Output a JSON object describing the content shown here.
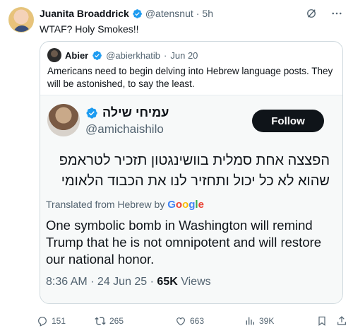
{
  "post": {
    "author_name": "Juanita Broaddrick",
    "author_handle": "@atensnut",
    "separator": "·",
    "time": "5h",
    "text": "WTAF?  Holy Smokes!!",
    "icons": {
      "grok": "grok-icon",
      "more": "more-icon",
      "verified": "verified-badge-icon"
    }
  },
  "quote": {
    "author_name": "Abier",
    "author_handle": "@abierkhatib",
    "separator": "·",
    "time": "Jun 20",
    "text": "Americans need to begin delving into Hebrew language posts. They will be astonished, to say the least."
  },
  "embedded": {
    "author_name": "עמיחי שילה",
    "author_handle": "@amichaishilo",
    "follow_label": "Follow",
    "hebrew_text": "הפצצה אחת סמלית בוושינגטון תזכיר לטראמפ שהוא לא כל יכול ותחזיר לנו את הכבוד הלאומי",
    "translated_label": "Translated from Hebrew by",
    "google": {
      "g1": "G",
      "g2": "o",
      "g3": "o",
      "g4": "g",
      "g5": "l",
      "g6": "e"
    },
    "translation": "One symbolic bomb in Washington will remind Trump that he is not omnipotent and will restore our national honor.",
    "timestamp": "8:36 AM · 24 Jun 25 · ",
    "views_count": "65K",
    "views_label": " Views"
  },
  "actions": {
    "replies": "151",
    "reposts": "265",
    "likes": "663",
    "views": "39K"
  },
  "colors": {
    "accent": "#1d9bf0",
    "text": "#0f1419",
    "muted": "#536471",
    "follow_bg": "#0f1419"
  }
}
